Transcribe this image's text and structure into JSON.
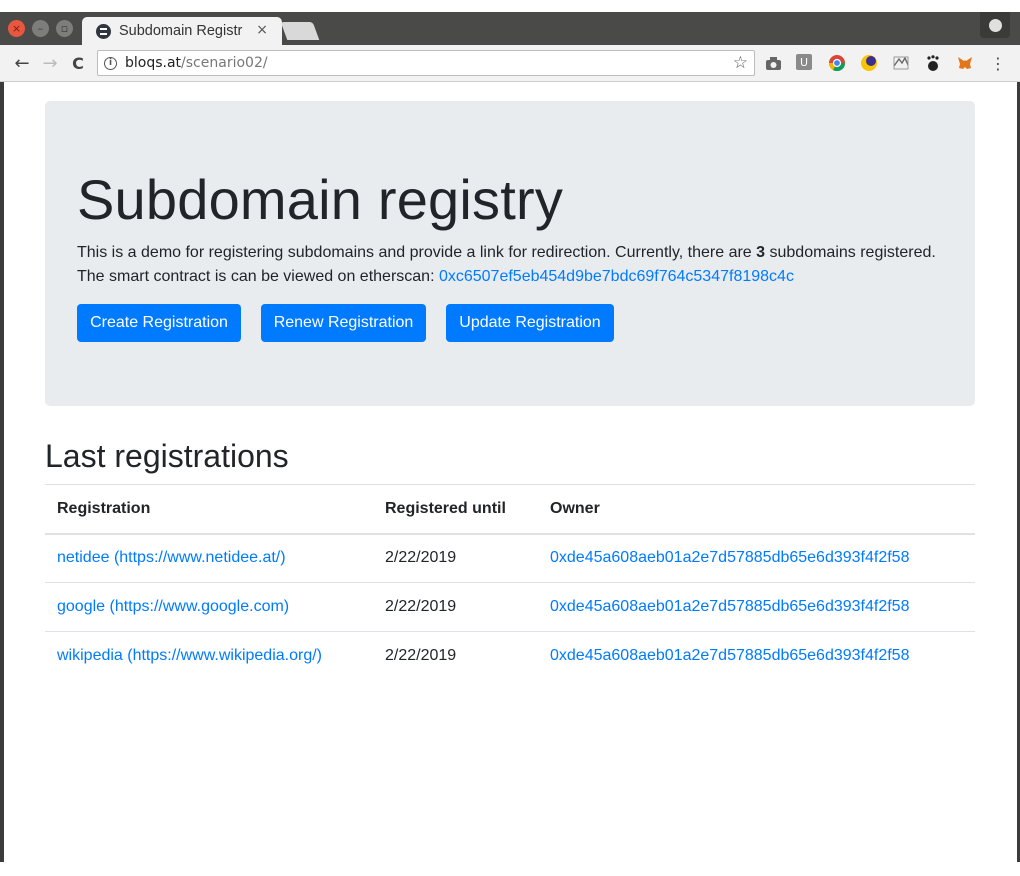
{
  "browser": {
    "tab_title": "Subdomain Registr",
    "tab_close": "×",
    "url_host": "bloqs.at",
    "url_path": "/scenario02/",
    "back": "←",
    "forward": "→",
    "reload": "C",
    "star": "☆",
    "menu": "⋮"
  },
  "jumbotron": {
    "title": "Subdomain registry",
    "line1_pre": "This is a demo for registering subdomains and provide a link for redirection. Currently, there are ",
    "count": "3",
    "line1_post": " subdomains registered.",
    "line2_pre": "The smart contract is can be viewed on etherscan: ",
    "contract": "0xc6507ef5eb454d9be7bdc69f764c5347f8198c4c",
    "buttons": {
      "create": "Create Registration",
      "renew": "Renew Registration",
      "update": "Update Registration"
    }
  },
  "registrations": {
    "title": "Last registrations",
    "headers": [
      "Registration",
      "Registered until",
      "Owner"
    ],
    "rows": [
      {
        "name": "netidee (https://www.netidee.at/)",
        "until": "2/22/2019",
        "owner": "0xde45a608aeb01a2e7d57885db65e6d393f4f2f58"
      },
      {
        "name": "google (https://www.google.com)",
        "until": "2/22/2019",
        "owner": "0xde45a608aeb01a2e7d57885db65e6d393f4f2f58"
      },
      {
        "name": "wikipedia (https://www.wikipedia.org/)",
        "until": "2/22/2019",
        "owner": "0xde45a608aeb01a2e7d57885db65e6d393f4f2f58"
      }
    ]
  },
  "icons": {
    "info": "info-icon",
    "camera": "camera-icon",
    "ublock": "U",
    "chrome": "chrome-icon",
    "moon": "moon-icon",
    "metamask": "metamask-icon"
  }
}
